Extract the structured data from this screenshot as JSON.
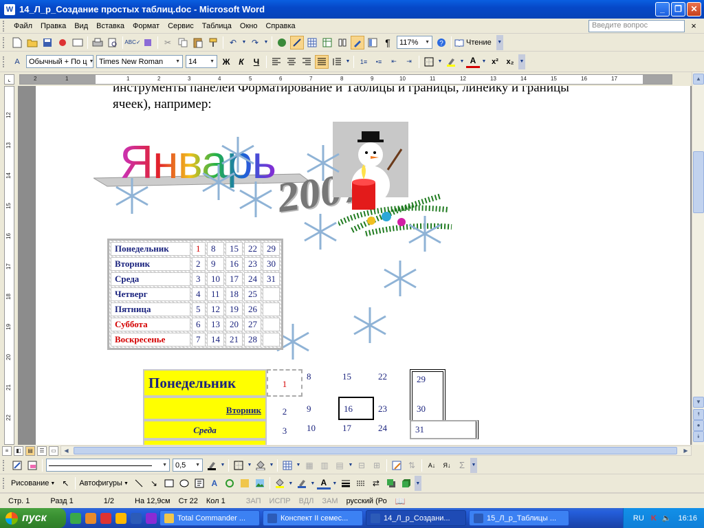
{
  "window": {
    "title": "14_Л_р_Создание простых таблиц.doc - Microsoft Word",
    "app_icon": "W"
  },
  "menu": {
    "items": [
      "Файл",
      "Правка",
      "Вид",
      "Вставка",
      "Формат",
      "Сервис",
      "Таблица",
      "Окно",
      "Справка"
    ],
    "ask_placeholder": "Введите вопрос",
    "close_glyph": "×"
  },
  "toolbar1": {
    "zoom": "117%",
    "reading": "Чтение"
  },
  "toolbar2": {
    "style": "Обычный + По ц",
    "font": "Times New Roman",
    "size": "14",
    "bold": "Ж",
    "italic": "К",
    "underline": "Ч"
  },
  "ruler": {
    "hnums": [
      "2",
      "1",
      "1",
      "2",
      "3",
      "4",
      "5",
      "6",
      "7",
      "8",
      "9",
      "10",
      "11",
      "12",
      "13",
      "14",
      "15",
      "16",
      "17"
    ],
    "vnums": [
      "12",
      "13",
      "14",
      "15",
      "16",
      "17",
      "18",
      "19",
      "20",
      "21",
      "22"
    ]
  },
  "document": {
    "line1": "инструменты панелей Форматирование и Таблицы и границы, линейку и границы",
    "line2": "ячеек), например:",
    "wordart": "Январь",
    "year": "2007",
    "table1": [
      {
        "day": "Понедельник",
        "nums": [
          "1",
          "8",
          "15",
          "22",
          "29"
        ],
        "red": false
      },
      {
        "day": "Вторник",
        "nums": [
          "2",
          "9",
          "16",
          "23",
          "30"
        ],
        "red": false
      },
      {
        "day": "Среда",
        "nums": [
          "3",
          "10",
          "17",
          "24",
          "31"
        ],
        "red": false
      },
      {
        "day": "Четверг",
        "nums": [
          "4",
          "11",
          "18",
          "25",
          ""
        ],
        "red": false
      },
      {
        "day": "Пятница",
        "nums": [
          "5",
          "12",
          "19",
          "26",
          ""
        ],
        "red": false
      },
      {
        "day": "Суббота",
        "nums": [
          "6",
          "13",
          "20",
          "27",
          ""
        ],
        "red": true
      },
      {
        "day": "Воскресенье",
        "nums": [
          "7",
          "14",
          "21",
          "28",
          ""
        ],
        "red": true
      }
    ],
    "table2": [
      {
        "day": "Понедельник",
        "nums": [
          "1",
          "8",
          "15",
          "22",
          "29"
        ]
      },
      {
        "day": "Вторник",
        "nums": [
          "2",
          "9",
          "16",
          "23",
          "30"
        ]
      },
      {
        "day": "Среда",
        "nums": [
          "3",
          "10",
          "17",
          "24",
          "31"
        ]
      }
    ]
  },
  "drawing_toolbar": {
    "line_width": "0,5",
    "drawing": "Рисование",
    "autoshapes": "Автофигуры"
  },
  "status": {
    "page": "Стр. 1",
    "section": "Разд 1",
    "pages": "1/2",
    "at": "На 12,9см",
    "line": "Ст 22",
    "col": "Кол 1",
    "rec": "ЗАП",
    "trk": "ИСПР",
    "ext": "ВДЛ",
    "ovr": "ЗАМ",
    "lang": "русский (Ро"
  },
  "taskbar": {
    "start": "пуск",
    "tasks": [
      "Total Commander ...",
      "Конспект II семес...",
      "14_Л_р_Создани...",
      "15_Л_р_Таблицы ..."
    ],
    "lang": "RU",
    "time": "16:16"
  }
}
